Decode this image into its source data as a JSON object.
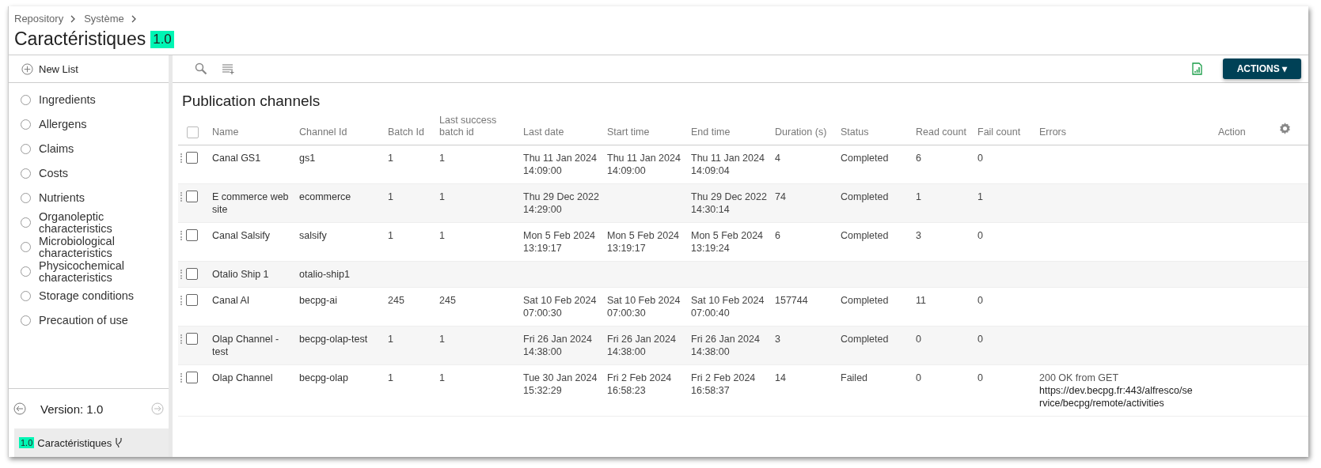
{
  "breadcrumb": [
    "Repository",
    "Système"
  ],
  "title": "Caractéristiques",
  "version_badge": "1.0",
  "sidebar": {
    "new_list": "New List",
    "items": [
      {
        "label": "Ingredients",
        "selected": false
      },
      {
        "label": "Allergens",
        "selected": false
      },
      {
        "label": "Claims",
        "selected": false
      },
      {
        "label": "Costs",
        "selected": false
      },
      {
        "label": "Nutrients",
        "selected": false
      },
      {
        "label": "Organoleptic characteristics",
        "selected": false
      },
      {
        "label": "Microbiological characteristics",
        "selected": false
      },
      {
        "label": "Physicochemical characteristics",
        "selected": false
      },
      {
        "label": "Storage conditions",
        "selected": false
      },
      {
        "label": "Precaution of use",
        "selected": false
      }
    ],
    "version": "Version: 1.0",
    "current": {
      "badge": "1.0",
      "name": "Caractéristiques"
    }
  },
  "toolbar": {
    "actions_button": "ACTIONS ▾"
  },
  "section_title": "Publication channels",
  "table": {
    "select_all": {
      "checked": false
    },
    "columns": [
      "Name",
      "Channel Id",
      "Batch Id",
      "Last success batch id",
      "Last date",
      "Start time",
      "End time",
      "Duration (s)",
      "Status",
      "Read count",
      "Fail count",
      "Errors",
      "Action"
    ],
    "rows": [
      {
        "checked": false,
        "cells": [
          "Canal GS1",
          "gs1",
          "1",
          "1",
          "Thu 11 Jan 2024 14:09:00",
          "Thu 11 Jan 2024 14:09:00",
          "Thu 11 Jan 2024 14:09:04",
          "4",
          "Completed",
          "6",
          "0"
        ]
      },
      {
        "checked": false,
        "cells": [
          "E commerce web site",
          "ecommerce",
          "1",
          "1",
          "Thu 29 Dec 2022 14:29:00",
          "",
          "Thu 29 Dec 2022 14:30:14",
          "74",
          "Completed",
          "1",
          "1"
        ]
      },
      {
        "checked": false,
        "cells": [
          "Canal Salsify",
          "salsify",
          "1",
          "1",
          "Mon 5 Feb 2024 13:19:17",
          "Mon 5 Feb 2024 13:19:17",
          "Mon 5 Feb 2024 13:19:24",
          "6",
          "Completed",
          "3",
          "0"
        ]
      },
      {
        "checked": false,
        "cells": [
          "Otalio Ship 1",
          "otalio-ship1",
          "",
          "",
          "",
          "",
          "",
          "",
          "",
          "",
          ""
        ]
      },
      {
        "checked": false,
        "cells": [
          "Canal AI",
          "becpg-ai",
          "245",
          "245",
          "Sat 10 Feb 2024 07:00:30",
          "Sat 10 Feb 2024 07:00:30",
          "Sat 10 Feb 2024 07:00:40",
          "157744",
          "Completed",
          "11",
          "0"
        ]
      },
      {
        "checked": false,
        "cells": [
          "Olap Channel - test",
          "becpg-olap-test",
          "1",
          "1",
          "Fri 26 Jan 2024 14:38:00",
          "Fri 26 Jan 2024 14:38:00",
          "Fri 26 Jan 2024 14:38:00",
          "3",
          "Completed",
          "0",
          "0"
        ]
      },
      {
        "checked": false,
        "cells": [
          "Olap Channel",
          "becpg-olap",
          "1",
          "1",
          "Tue 30 Jan 2024 15:32:29",
          "Fri 2 Feb 2024 16:58:23",
          "Fri 2 Feb 2024 16:58:37",
          "14",
          "Failed",
          "0",
          "0"
        ],
        "error": {
          "message": "200 OK from GET",
          "url": "https://dev.becpg.fr:443/alfresco/service/becpg/remote/activities"
        }
      }
    ]
  }
}
